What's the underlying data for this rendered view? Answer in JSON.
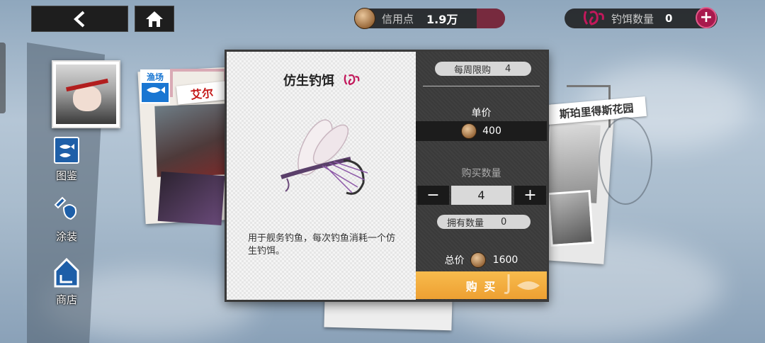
{
  "top_bar": {
    "credits_label": "信用点",
    "credits_value": "1.9万",
    "bait_label": "钓饵数量",
    "bait_value": "0"
  },
  "sidebar": {
    "items": [
      {
        "label": "图鉴",
        "icon": "fish-book-icon"
      },
      {
        "label": "涂装",
        "icon": "paint-icon"
      },
      {
        "label": "商店",
        "icon": "shop-icon"
      }
    ]
  },
  "background": {
    "left_tag": "渔场",
    "left_banner": "艾尔",
    "right_banner": "斯珀里得斯花园"
  },
  "dialog": {
    "item_name": "仿生钓饵",
    "description": "用于舰务钓鱼，每次钓鱼消耗一个仿生钓饵。",
    "weekly_limit_label": "每周限购",
    "weekly_limit_value": "4",
    "unit_price_label": "单价",
    "unit_price_value": "400",
    "quantity_label": "购买数量",
    "quantity_value": "4",
    "minus_symbol": "−",
    "plus_symbol": "+",
    "owned_label": "拥有数量",
    "owned_value": "0",
    "total_label": "总价",
    "total_value": "1600",
    "buy_label": "购 买"
  },
  "colors": {
    "accent_pink": "#c2185b",
    "buy_orange": "#f2a93b",
    "dark_panel": "#3c3c3c"
  }
}
